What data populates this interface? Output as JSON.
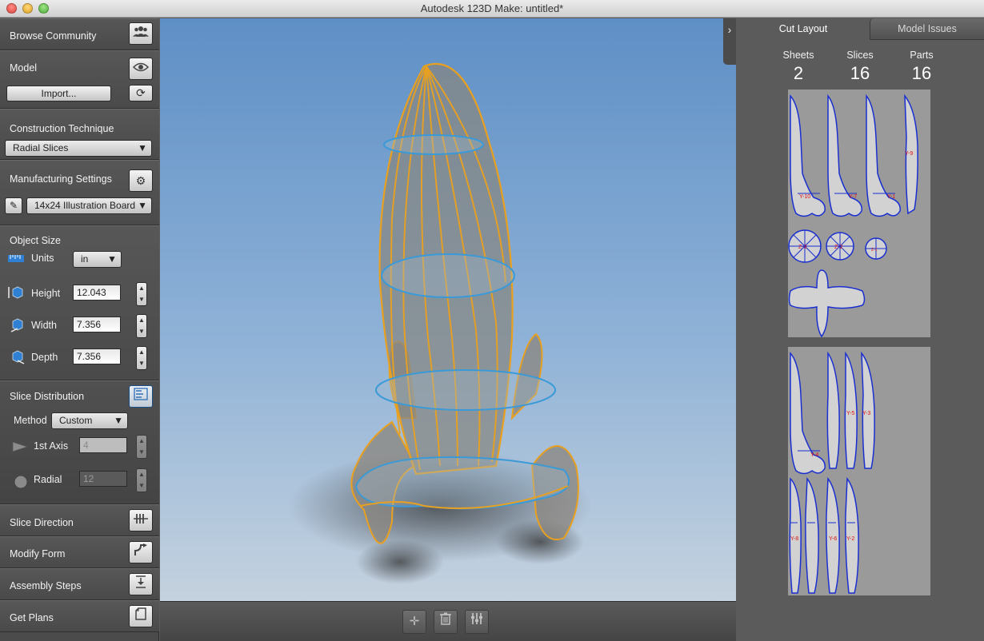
{
  "window": {
    "title": "Autodesk 123D Make: untitled*"
  },
  "left_panel": {
    "browse": {
      "label": "Browse Community",
      "icon": "community-icon"
    },
    "model": {
      "label": "Model",
      "import_label": "Import...",
      "icon": "eye-icon"
    },
    "construction": {
      "label": "Construction Technique",
      "value": "Radial Slices"
    },
    "manufacturing": {
      "label": "Manufacturing Settings",
      "value": "14x24 Illustration Board"
    },
    "object_size": {
      "label": "Object Size",
      "units_label": "Units",
      "units_value": "in",
      "height_label": "Height",
      "height_value": "12.043",
      "width_label": "Width",
      "width_value": "7.356",
      "depth_label": "Depth",
      "depth_value": "7.356"
    },
    "slice_distribution": {
      "label": "Slice Distribution",
      "method_label": "Method",
      "method_value": "Custom",
      "axis_label": "1st Axis",
      "axis_value": "4",
      "radial_label": "Radial",
      "radial_value": "12"
    },
    "slice_direction": {
      "label": "Slice Direction"
    },
    "modify_form": {
      "label": "Modify Form"
    },
    "assembly_steps": {
      "label": "Assembly Steps"
    },
    "get_plans": {
      "label": "Get Plans"
    }
  },
  "right_panel": {
    "tabs": [
      "Cut Layout",
      "Model Issues"
    ],
    "stats": [
      {
        "label": "Sheets",
        "value": "2"
      },
      {
        "label": "Slices",
        "value": "16"
      },
      {
        "label": "Parts",
        "value": "16"
      }
    ],
    "sheet1_labels": [
      "Y-10",
      "Y-7",
      "Y-1",
      "Y-9",
      "Z-3",
      "Z-2",
      "Z-1"
    ],
    "sheet2_labels": [
      "Y-4",
      "Y-5",
      "Y-3",
      "Y-8",
      "Y-6",
      "Y-2"
    ]
  },
  "colors": {
    "viewport_top": "#5e8fc6",
    "slice_edge": "#e8a020",
    "ring_edge": "#3a9ad8",
    "part_outline": "#1a2fd0",
    "part_label": "#e01010"
  }
}
